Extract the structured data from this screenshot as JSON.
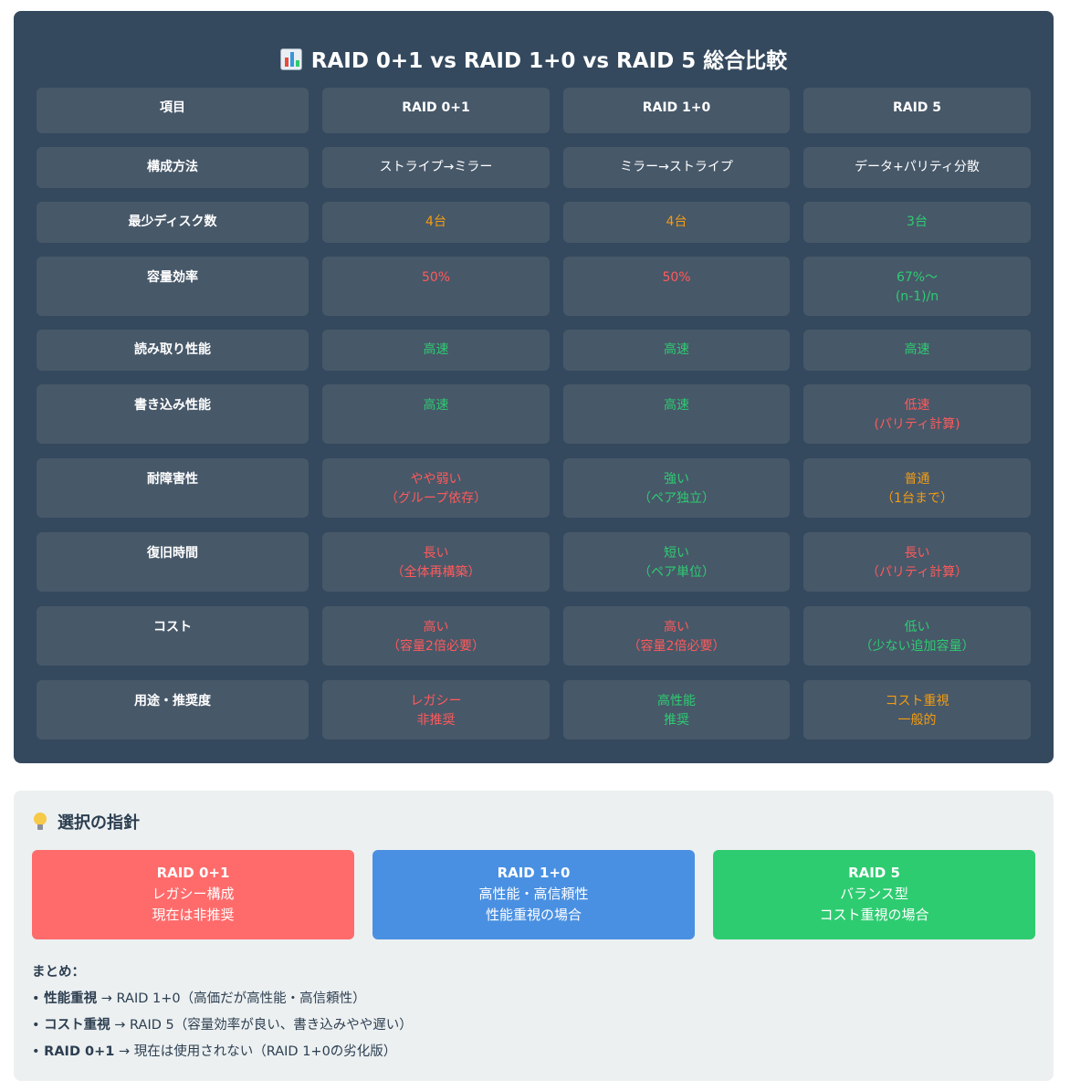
{
  "title": "RAID 0+1 vs RAID 1+0 vs RAID 5 総合比較",
  "title_icon": "bar-chart-icon",
  "table": {
    "headers": [
      "項目",
      "RAID 0+1",
      "RAID 1+0",
      "RAID 5"
    ],
    "rows": [
      {
        "label": "構成方法",
        "cells": [
          {
            "lines": [
              "ストライプ→ミラー"
            ],
            "color": "white"
          },
          {
            "lines": [
              "ミラー→ストライプ"
            ],
            "color": "white"
          },
          {
            "lines": [
              "データ+パリティ分散"
            ],
            "color": "white"
          }
        ]
      },
      {
        "label": "最少ディスク数",
        "cells": [
          {
            "lines": [
              "4台"
            ],
            "color": "orange"
          },
          {
            "lines": [
              "4台"
            ],
            "color": "orange"
          },
          {
            "lines": [
              "3台"
            ],
            "color": "green"
          }
        ]
      },
      {
        "label": "容量効率",
        "cells": [
          {
            "lines": [
              "50%"
            ],
            "color": "red"
          },
          {
            "lines": [
              "50%"
            ],
            "color": "red"
          },
          {
            "lines": [
              "67%～",
              "(n-1)/n"
            ],
            "color": "green"
          }
        ]
      },
      {
        "label": "読み取り性能",
        "cells": [
          {
            "lines": [
              "高速"
            ],
            "color": "green"
          },
          {
            "lines": [
              "高速"
            ],
            "color": "green"
          },
          {
            "lines": [
              "高速"
            ],
            "color": "green"
          }
        ]
      },
      {
        "label": "書き込み性能",
        "cells": [
          {
            "lines": [
              "高速"
            ],
            "color": "green"
          },
          {
            "lines": [
              "高速"
            ],
            "color": "green"
          },
          {
            "lines": [
              "低速",
              "(パリティ計算)"
            ],
            "color": "red"
          }
        ]
      },
      {
        "label": "耐障害性",
        "cells": [
          {
            "lines": [
              "やや弱い",
              "（グループ依存）"
            ],
            "color": "red"
          },
          {
            "lines": [
              "強い",
              "（ペア独立）"
            ],
            "color": "green"
          },
          {
            "lines": [
              "普通",
              "（1台まで）"
            ],
            "color": "orange"
          }
        ]
      },
      {
        "label": "復旧時間",
        "cells": [
          {
            "lines": [
              "長い",
              "（全体再構築）"
            ],
            "color": "red"
          },
          {
            "lines": [
              "短い",
              "（ペア単位）"
            ],
            "color": "green"
          },
          {
            "lines": [
              "長い",
              "（パリティ計算）"
            ],
            "color": "red"
          }
        ]
      },
      {
        "label": "コスト",
        "cells": [
          {
            "lines": [
              "高い",
              "（容量2倍必要）"
            ],
            "color": "red"
          },
          {
            "lines": [
              "高い",
              "（容量2倍必要）"
            ],
            "color": "red"
          },
          {
            "lines": [
              "低い",
              "（少ない追加容量）"
            ],
            "color": "green"
          }
        ]
      },
      {
        "label": "用途・推奨度",
        "cells": [
          {
            "lines": [
              "レガシー",
              "非推奨"
            ],
            "color": "red"
          },
          {
            "lines": [
              "高性能",
              "推奨"
            ],
            "color": "green"
          },
          {
            "lines": [
              "コスト重視",
              "一般的"
            ],
            "color": "orange"
          }
        ]
      }
    ]
  },
  "colors": {
    "white": "#ffffff",
    "orange": "#f39c12",
    "red": "#ff5a5a",
    "green": "#2ecc71"
  },
  "guide": {
    "title": "選択の指針",
    "title_icon": "light-bulb-icon",
    "cards": [
      {
        "title": "RAID 0+1",
        "lines": [
          "レガシー構成",
          "現在は非推奨"
        ],
        "color": "#ff6b6b"
      },
      {
        "title": "RAID 1+0",
        "lines": [
          "高性能・高信頼性",
          "性能重視の場合"
        ],
        "color": "#4a90e2"
      },
      {
        "title": "RAID 5",
        "lines": [
          "バランス型",
          "コスト重視の場合"
        ],
        "color": "#2ecc71"
      }
    ]
  },
  "summary": {
    "heading": "まとめ：",
    "items": [
      {
        "bullet": "•",
        "key": "性能重視",
        "arrow": "→",
        "text": "RAID 1+0（高価だが高性能・高信頼性）"
      },
      {
        "bullet": "•",
        "key": "コスト重視",
        "arrow": "→",
        "text": "RAID 5（容量効率が良い、書き込みやや遅い）"
      },
      {
        "bullet": "•",
        "key": "RAID 0+1",
        "arrow": "→",
        "text": "現在は使用されない（RAID 1+0の劣化版）"
      }
    ]
  }
}
